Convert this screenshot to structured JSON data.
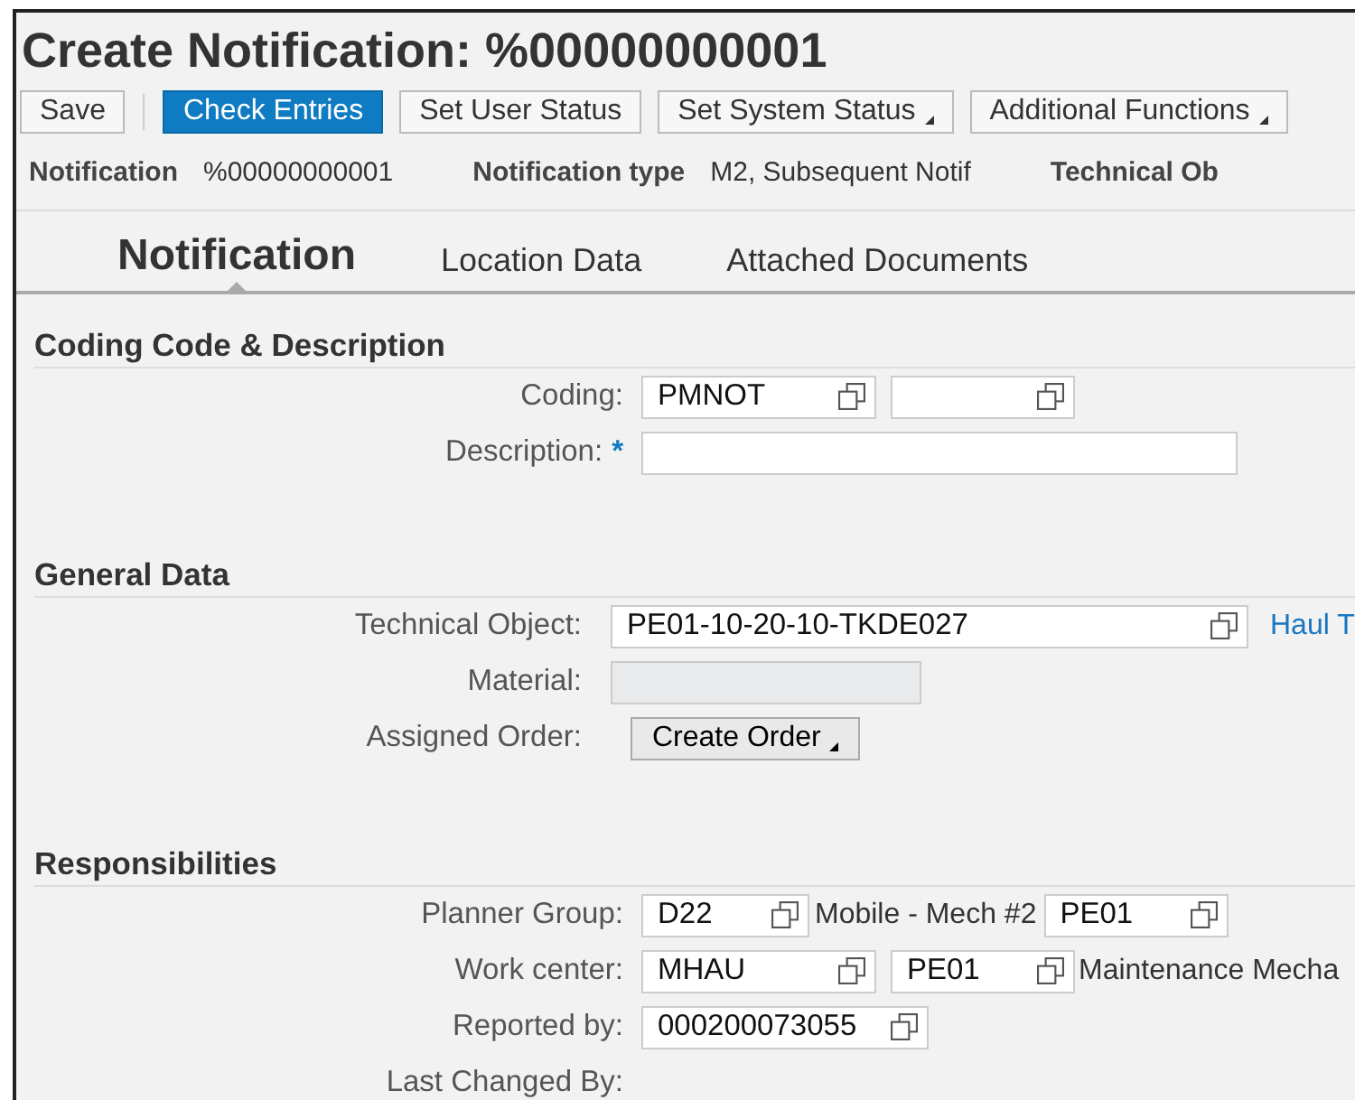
{
  "window": {
    "title": "Create Notification: %00000000001"
  },
  "toolbar": [
    {
      "label": "Save",
      "primary": false,
      "menu": false
    },
    {
      "label": "Check Entries",
      "primary": true,
      "menu": false
    },
    {
      "label": "Set User Status",
      "primary": false,
      "menu": false
    },
    {
      "label": "Set System Status",
      "primary": false,
      "menu": true
    },
    {
      "label": "Additional Functions",
      "primary": false,
      "menu": true
    }
  ],
  "header": [
    {
      "label": "Notification",
      "value": "%00000000001"
    },
    {
      "label": "Notification type",
      "value": "M2, Subsequent Notif"
    },
    {
      "label": "Technical Ob"
    }
  ],
  "tabs": [
    {
      "label": "Notification",
      "selected": true
    },
    {
      "label": "Location Data",
      "selected": false
    },
    {
      "label": "Attached Documents",
      "selected": false
    }
  ],
  "sections": [
    {
      "title": "Coding Code & Description",
      "rows": [
        {
          "label": "Coding:",
          "parts": [
            {
              "kind": "field",
              "value": "PMNOT"
            },
            {
              "kind": "field"
            }
          ]
        },
        {
          "label": "Description:",
          "required_mark": "*",
          "parts": [
            {
              "kind": "text-field"
            }
          ]
        }
      ]
    },
    {
      "title": "General Data",
      "rows": [
        {
          "label": "Technical Object:",
          "parts": [
            {
              "kind": "long-field",
              "value": "PE01-10-20-10-TKDE027"
            },
            {
              "kind": "link",
              "text": "Haul T"
            }
          ]
        },
        {
          "label": "Material:",
          "parts": [
            {
              "kind": "display-field"
            }
          ]
        },
        {
          "label": "Assigned Order:",
          "parts": [
            {
              "kind": "menu-button",
              "text": "Create Order"
            }
          ]
        }
      ]
    },
    {
      "title": "Responsibilities",
      "rows": [
        {
          "label": "Planner Group:",
          "parts": [
            {
              "kind": "field",
              "value": "D22"
            },
            {
              "kind": "text",
              "text": "Mobile - Mech #2"
            },
            {
              "kind": "field",
              "value": "PE01"
            }
          ]
        },
        {
          "label": "Work center:",
          "parts": [
            {
              "kind": "field",
              "value": "MHAU"
            },
            {
              "kind": "field",
              "value": "PE01"
            },
            {
              "kind": "text",
              "text": "Maintenance Mecha"
            }
          ]
        },
        {
          "label": "Reported by:",
          "parts": [
            {
              "kind": "field",
              "value": "000200073055"
            }
          ]
        },
        {
          "label": "Last Changed By:",
          "parts": []
        }
      ]
    }
  ]
}
